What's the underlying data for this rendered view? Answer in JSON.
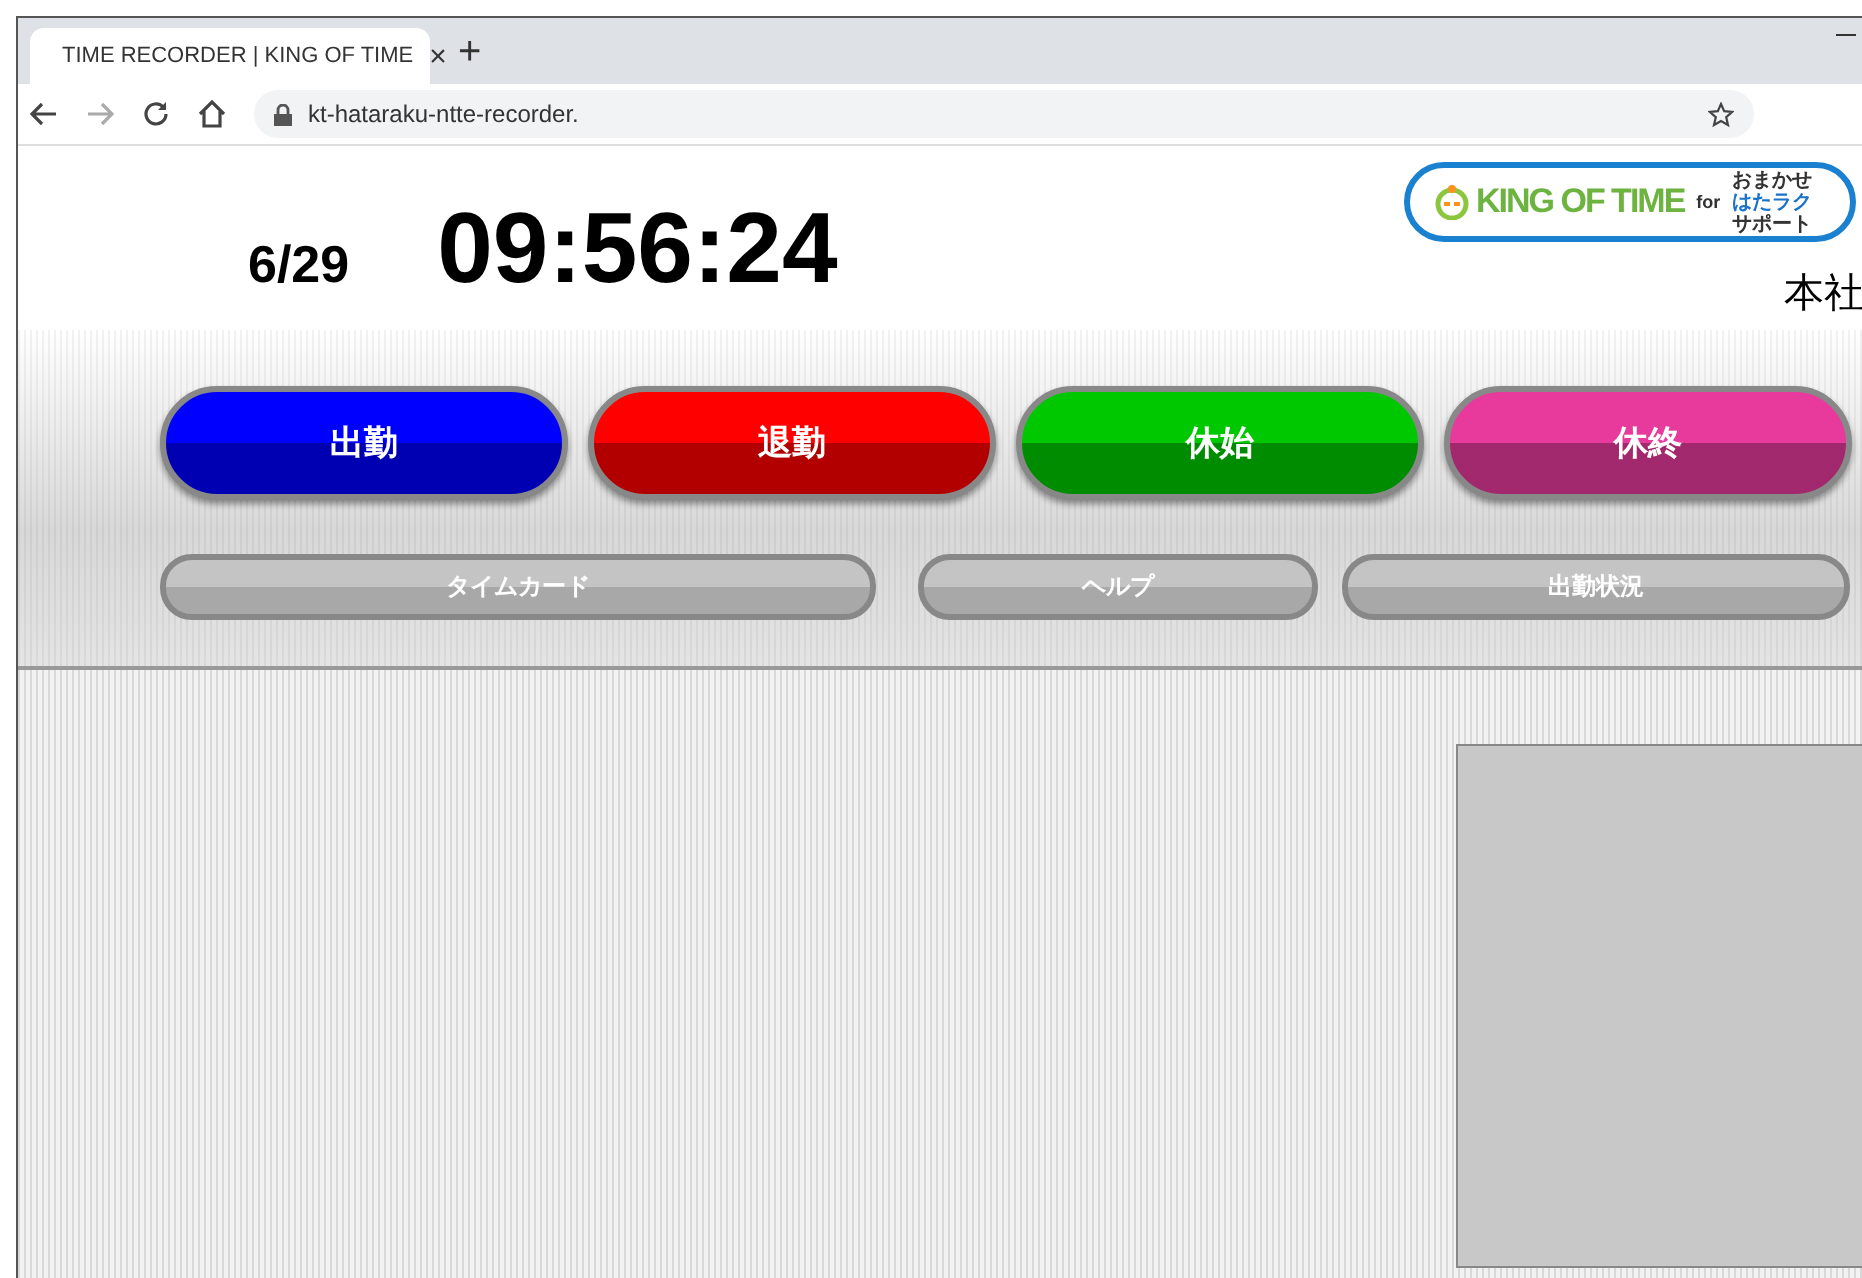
{
  "browser": {
    "tab": {
      "title": "TIME RECORDER | KING OF TIME",
      "close": "×",
      "selected": true
    },
    "new_tab": "+",
    "address": "kt-hataraku-ntte-recorder."
  },
  "header": {
    "date": "6/29",
    "time": "09:56:24",
    "logo": {
      "brand": "KING OF TIME",
      "for": "for",
      "tagline": [
        {
          "text": "おまかせ",
          "color": "#333333"
        },
        {
          "text": "はたラク",
          "color": "#1a73c8"
        },
        {
          "text": "サポート",
          "color": "#333333"
        }
      ]
    },
    "office": "本社"
  },
  "punch_buttons": [
    {
      "label": "出勤",
      "color": "#0000ff"
    },
    {
      "label": "退勤",
      "color": "#ff0000"
    },
    {
      "label": "休始",
      "color": "#00c800"
    },
    {
      "label": "休終",
      "color": "#e83a9c"
    }
  ],
  "menu_buttons": [
    "タイムカード",
    "ヘルプ",
    "出勤状況"
  ]
}
